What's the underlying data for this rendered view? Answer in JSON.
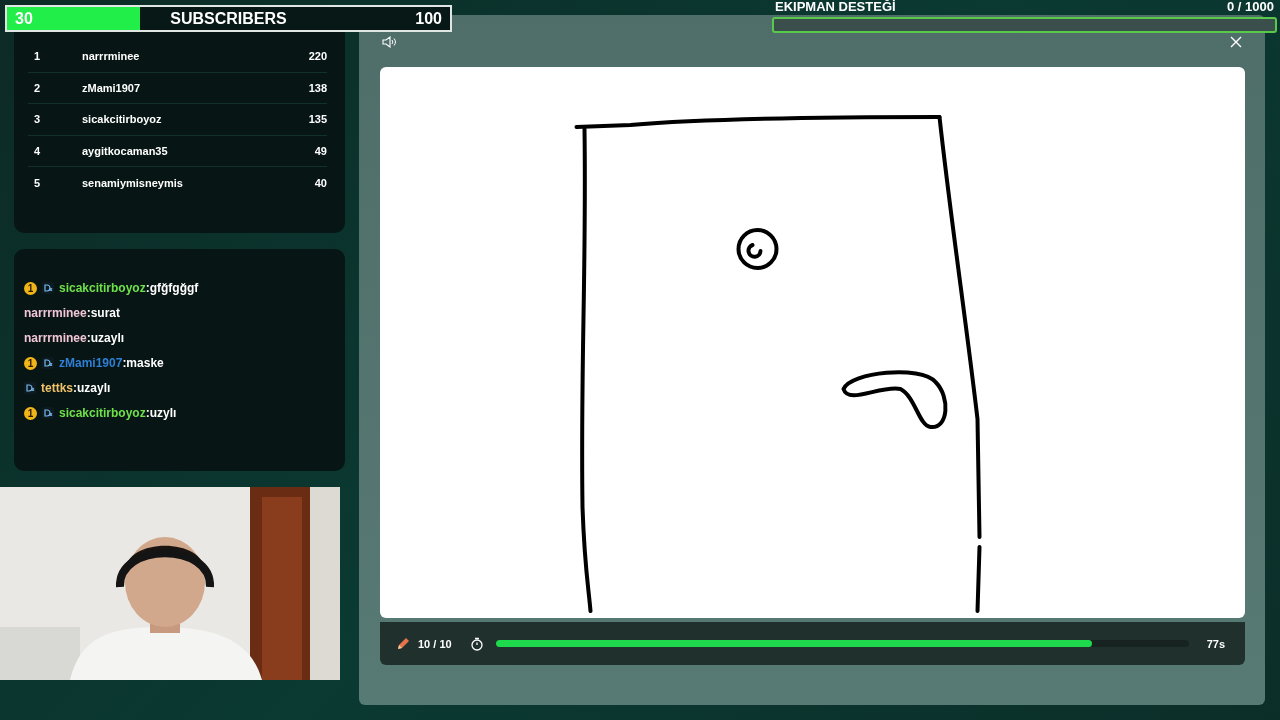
{
  "subscriber_goal": {
    "current": "30",
    "label": "SUBSCRIBERS",
    "target": "100",
    "level": 0.3
  },
  "leaderboard": [
    {
      "rank": "1",
      "name": "narrrminee",
      "score": "220"
    },
    {
      "rank": "2",
      "name": "zMami1907",
      "score": "138"
    },
    {
      "rank": "3",
      "name": "sicakcitirboyoz",
      "score": "135"
    },
    {
      "rank": "4",
      "name": "aygitkocaman35",
      "score": "49"
    },
    {
      "rank": "5",
      "name": "senamiymisneymis",
      "score": "40"
    }
  ],
  "chat": [
    {
      "badge": "1",
      "dx_icon": true,
      "user": "sicakcitirboyoz",
      "color": "#6fe04a",
      "message": ":gfğfgğgf"
    },
    {
      "dx_icon": false,
      "user": "narrrminee",
      "color": "#f2c6d6",
      "message": ":surat"
    },
    {
      "dx_icon": false,
      "user": "narrrminee",
      "color": "#f2c6d6",
      "message": ":uzaylı"
    },
    {
      "badge": "1",
      "dx_icon": true,
      "user": "zMami1907",
      "color": "#2f7fd6",
      "message": ":maske"
    },
    {
      "dx_icon": true,
      "user": "tettks",
      "color": "#f0c36a",
      "message": ":uzaylı"
    },
    {
      "badge": "1",
      "dx_icon": true,
      "user": "sicakcitirboyoz",
      "color": "#6fe04a",
      "message": ":uzylı"
    }
  ],
  "equipment_goal": {
    "label": "EKIPMAN DESTEĞİ",
    "count": "0 / 1000",
    "level": 0
  },
  "game": {
    "strokes": "10 / 10",
    "timer": {
      "level": 0.86,
      "reading": "77s"
    }
  }
}
